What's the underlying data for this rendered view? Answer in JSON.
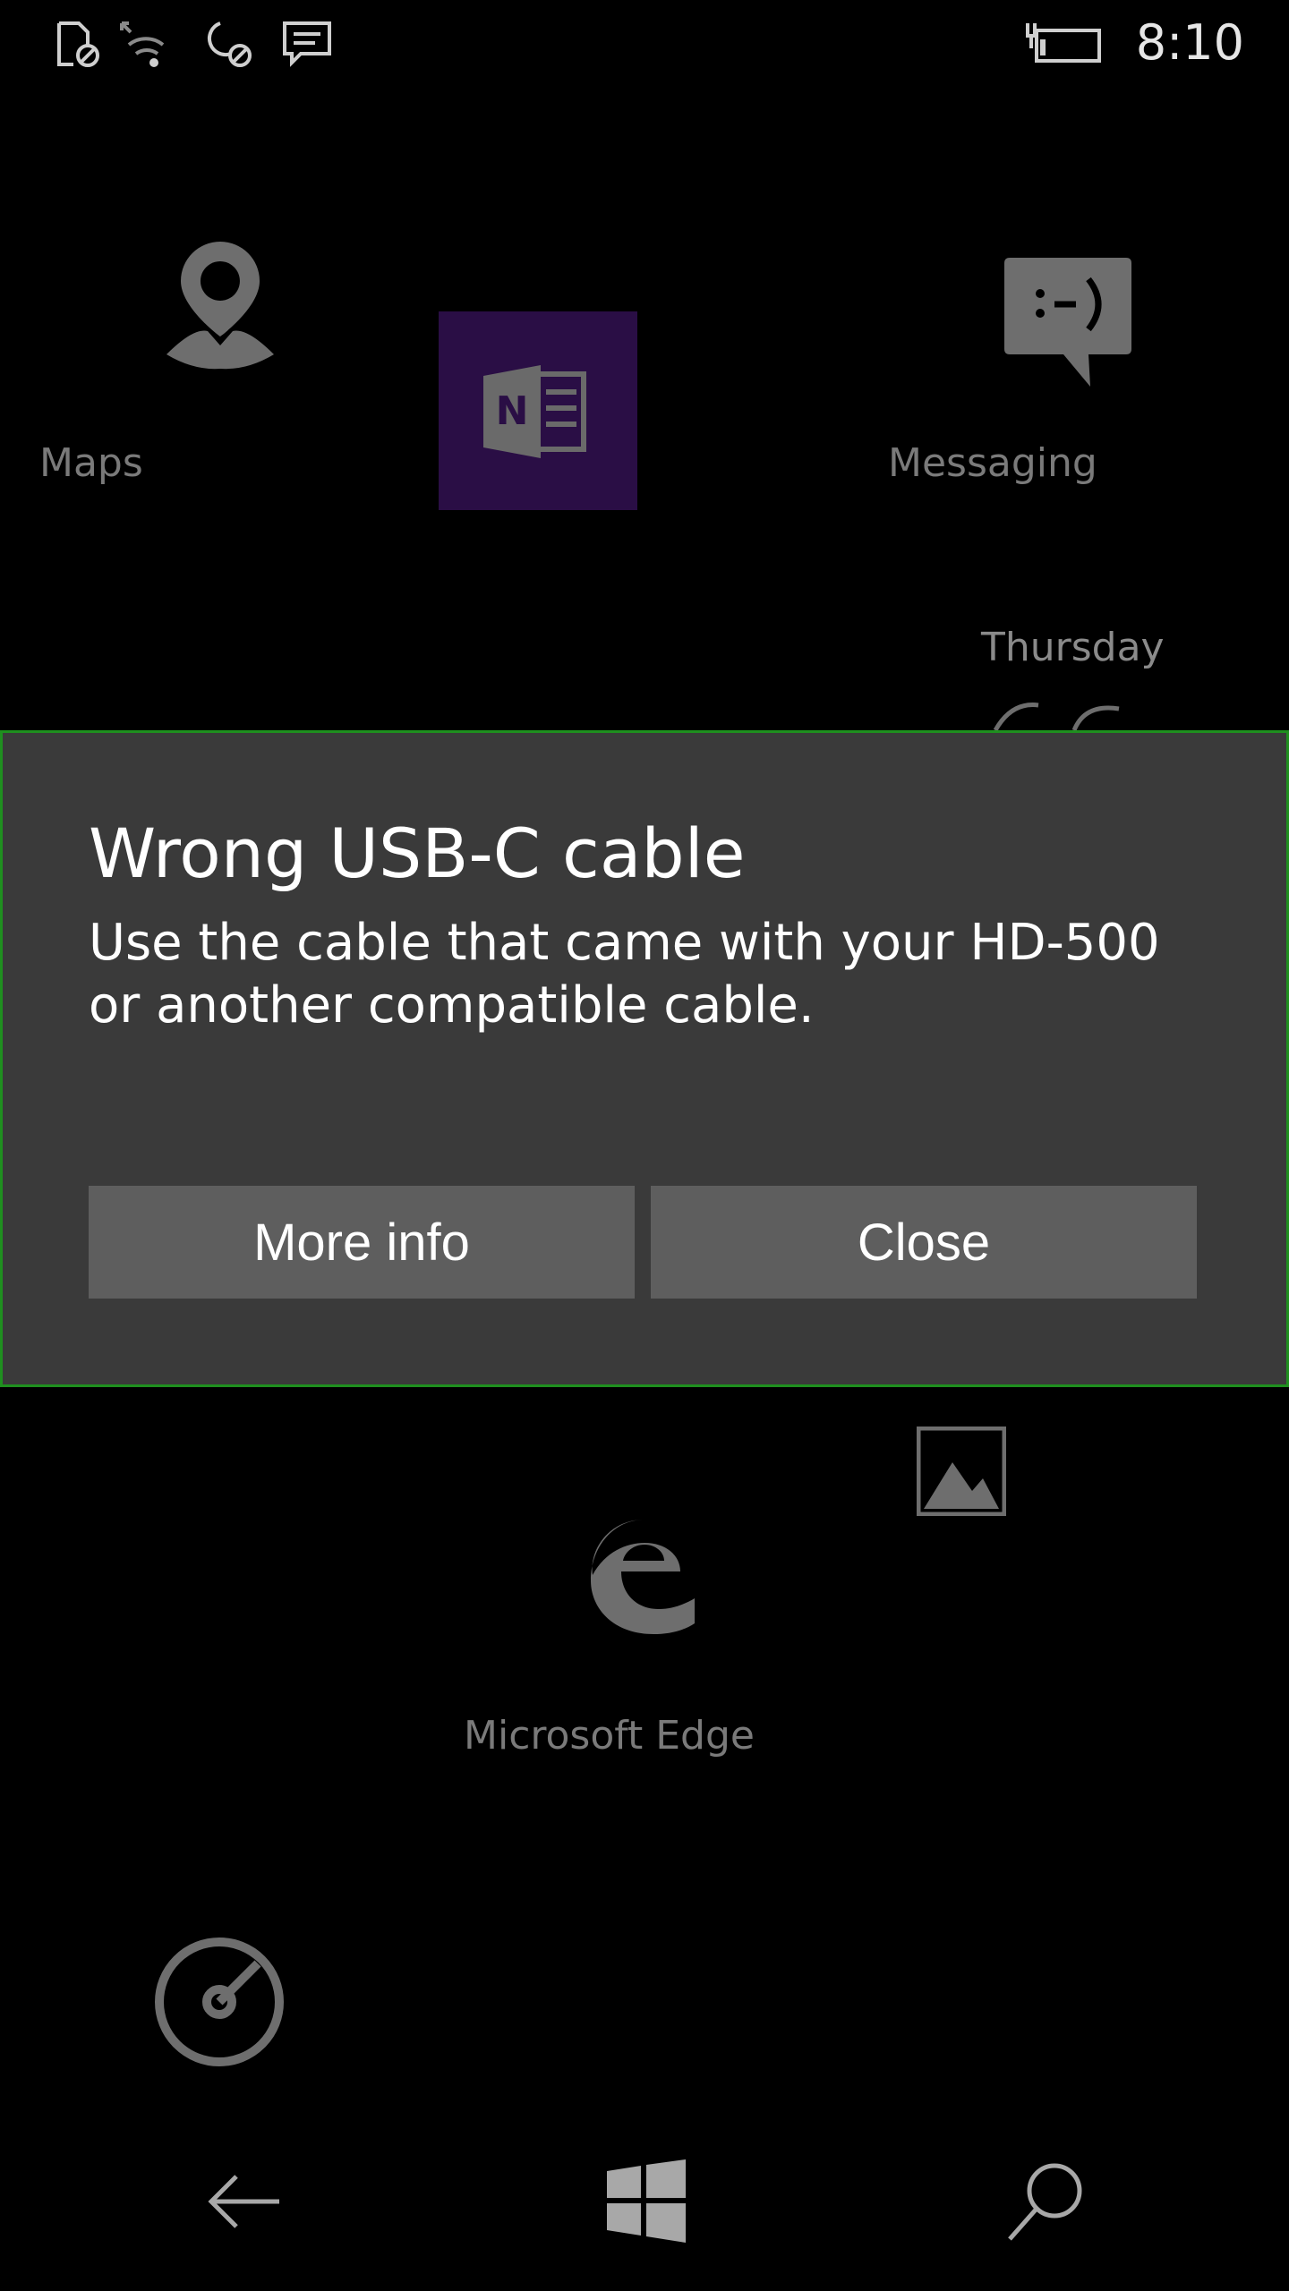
{
  "status_bar": {
    "time": "8:10",
    "icons": [
      "sim-blocked-icon",
      "wifi-icon",
      "quiet-hours-icon",
      "message-icon",
      "battery-charging-icon"
    ]
  },
  "start_screen": {
    "tiles": [
      {
        "label": "Maps",
        "icon": "maps-icon"
      },
      {
        "label": "",
        "icon": "onenote-icon"
      },
      {
        "label": "Messaging",
        "icon": "messaging-icon"
      },
      {
        "label": "",
        "icon": "photos-icon"
      },
      {
        "label": "Microsoft Edge",
        "icon": "edge-icon"
      },
      {
        "label": "",
        "icon": "groove-music-icon"
      }
    ],
    "calendar_day": "Thursday",
    "onenote_letter": "N"
  },
  "dialog": {
    "title": "Wrong USB-C cable",
    "message": "Use the cable that came with your HD-500 or another compatible cable.",
    "more_info_label": "More info",
    "close_label": "Close",
    "border_color": "#1f8f1f"
  },
  "nav_bar": {
    "icons": [
      "back-icon",
      "windows-start-icon",
      "search-icon"
    ]
  },
  "colors": {
    "background": "#000000",
    "dialog_bg": "#3a3a3a",
    "button_bg": "#5e5e5e",
    "onenote_tile": "#2a0e45"
  }
}
